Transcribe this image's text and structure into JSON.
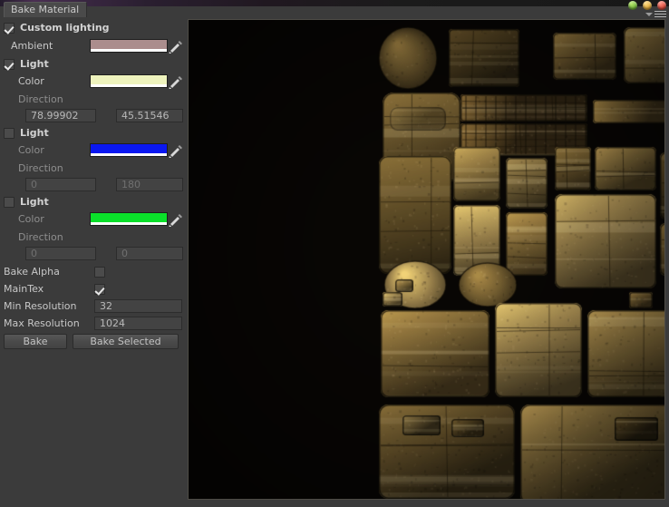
{
  "window": {
    "tab_label": "Bake Material",
    "controls": [
      {
        "name": "minimize",
        "color": "#7bbd33"
      },
      {
        "name": "maximize",
        "color": "#e0a42a"
      },
      {
        "name": "close",
        "color": "#d8372a"
      }
    ],
    "menu_icon": "hamburger-menu-icon"
  },
  "panel": {
    "custom_lighting": {
      "label": "Custom lighting",
      "checked": true
    },
    "ambient": {
      "label": "Ambient",
      "color": "#ab8d8d",
      "alpha_color": "#ffffff",
      "picker_icon": "eyedropper-icon"
    },
    "lights": [
      {
        "label": "Light",
        "enabled": true,
        "color_label": "Color",
        "color": "#eef3bd",
        "alpha_color": "#ffffff",
        "direction_label": "Direction",
        "direction_x": "78.99902",
        "direction_y": "45.51546",
        "dim": false
      },
      {
        "label": "Light",
        "enabled": false,
        "color_label": "Color",
        "color": "#0a17f0",
        "alpha_color": "#ffffff",
        "direction_label": "Direction",
        "direction_x": "0",
        "direction_y": "180",
        "dim": true
      },
      {
        "label": "Light",
        "enabled": false,
        "color_label": "Color",
        "color": "#0ae02a",
        "alpha_color": "#ffffff",
        "direction_label": "Direction",
        "direction_x": "0",
        "direction_y": "0",
        "dim": true
      }
    ],
    "bake_alpha": {
      "label": "Bake Alpha",
      "checked": false
    },
    "main_tex": {
      "label": "MainTex",
      "checked": true
    },
    "min_resolution": {
      "label": "Min Resolution",
      "value": "32"
    },
    "max_resolution": {
      "label": "Max Resolution",
      "value": "1024"
    },
    "bake_button": "Bake",
    "bake_selected_button": "Bake Selected"
  },
  "preview": {
    "name": "baked-texture-atlas-preview",
    "background": "#080604",
    "border": "#4e4c46",
    "description": "Baked texture atlas of military tactical gear: vests, pouches, boots, backpacks and webbing in olive and khaki tones"
  }
}
